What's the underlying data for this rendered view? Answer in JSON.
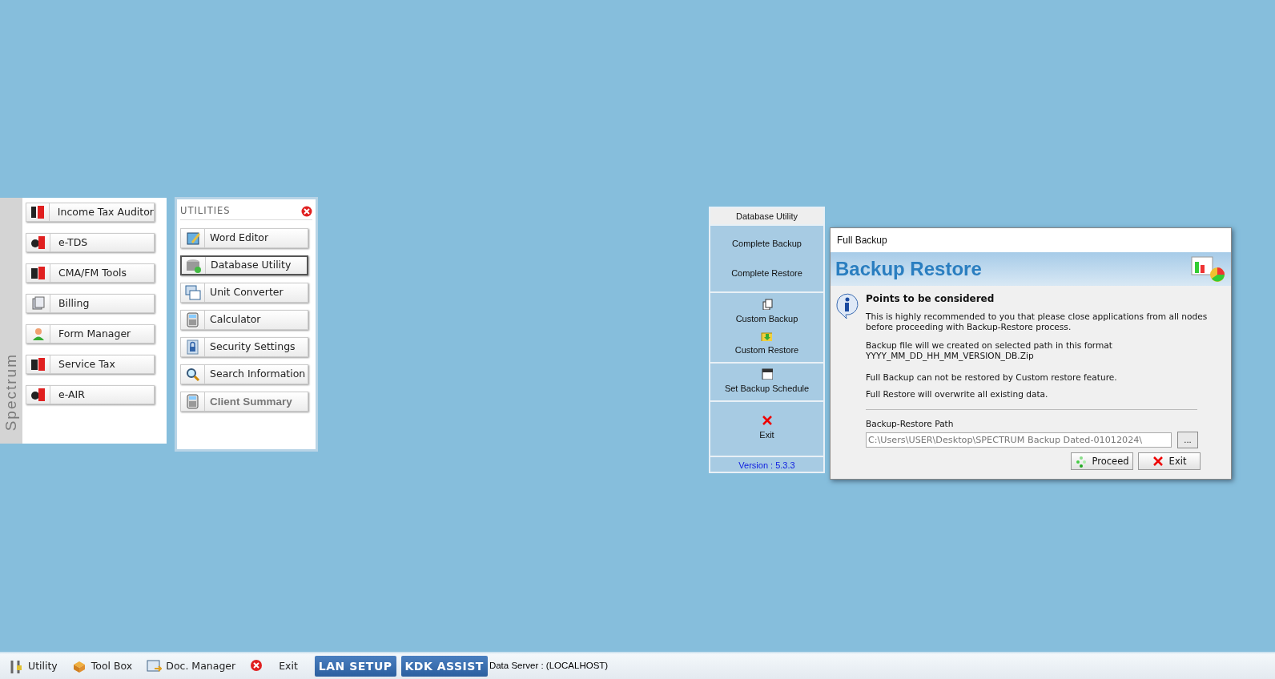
{
  "main_menu": {
    "side_label": "Spectrum",
    "items": [
      {
        "label": "Income Tax Auditor",
        "kind": "itax"
      },
      {
        "label": "e-TDS",
        "kind": "etds"
      },
      {
        "label": "CMA/FM Tools",
        "kind": "cma"
      },
      {
        "label": "Billing",
        "kind": "billing"
      },
      {
        "label": "Form Manager",
        "kind": "person"
      },
      {
        "label": "Service Tax",
        "kind": "stax"
      },
      {
        "label": "e-AIR",
        "kind": "eair"
      }
    ]
  },
  "utilities": {
    "title": "UTILITIES",
    "items": [
      {
        "label": "Word Editor",
        "kind": "editor",
        "selected": false,
        "disabled": false
      },
      {
        "label": "Database Utility",
        "kind": "database",
        "selected": true,
        "disabled": false
      },
      {
        "label": "Unit Converter",
        "kind": "converter",
        "selected": false,
        "disabled": false
      },
      {
        "label": "Calculator",
        "kind": "calculator",
        "selected": false,
        "disabled": false
      },
      {
        "label": "Security Settings",
        "kind": "lock",
        "selected": false,
        "disabled": false
      },
      {
        "label": "Search Information",
        "kind": "search",
        "selected": false,
        "disabled": false
      },
      {
        "label": "Client Summary",
        "kind": "calculator",
        "selected": false,
        "disabled": true
      }
    ]
  },
  "database_utility": {
    "title": "Database Utility",
    "groups": [
      {
        "items": [
          {
            "label": "Complete Backup",
            "kind": "plain"
          },
          {
            "label": "Complete Restore",
            "kind": "plain"
          }
        ]
      },
      {
        "items": [
          {
            "label": "Custom Backup",
            "kind": "copy"
          },
          {
            "label": "Custom Restore",
            "kind": "import"
          }
        ]
      },
      {
        "items": [
          {
            "label": "Set Backup Schedule",
            "kind": "schedule"
          }
        ]
      },
      {
        "items": [
          {
            "label": "Exit",
            "kind": "close"
          }
        ]
      }
    ],
    "version": "Version : 5.3.3"
  },
  "dialog": {
    "title": "Full Backup",
    "banner": "Backup Restore",
    "heading": "Points to be considered",
    "paragraphs": [
      "This is highly recommended to you that please close applications from all nodes before proceeding with Backup-Restore process.",
      "Backup file will we created on selected path in this format\nYYYY_MM_DD_HH_MM_VERSION_DB.Zip",
      "Full Backup can not be restored by Custom restore feature.",
      "Full Restore will overwrite all existing data."
    ],
    "path_label": "Backup-Restore Path",
    "path_value": "C:\\Users\\USER\\Desktop\\SPECTRUM Backup Dated-01012024\\",
    "browse": "...",
    "buttons": [
      {
        "label": "Proceed",
        "kind": "proceed"
      },
      {
        "label": "Exit",
        "kind": "exit"
      }
    ]
  },
  "taskbar": {
    "items": [
      {
        "label": "Utility",
        "kind": "tools"
      },
      {
        "label": "Tool Box",
        "kind": "box"
      },
      {
        "label": "Doc. Manager",
        "kind": "doc"
      },
      {
        "label": "Exit",
        "kind": "exit"
      },
      {
        "label": "LAN SETUP",
        "kind": "badge"
      },
      {
        "label": "KDK ASSIST",
        "kind": "badge"
      }
    ],
    "status": "Data Server : (LOCALHOST)"
  }
}
